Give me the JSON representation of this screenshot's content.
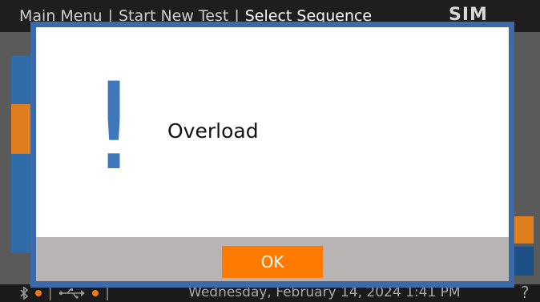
{
  "header": {
    "breadcrumb": [
      "Main Menu",
      "Start New Test",
      "Select Sequence"
    ],
    "separator": "|",
    "brand": "SIM"
  },
  "statusbar": {
    "separator": "|",
    "datetime": "Wednesday, February 14, 2024 1:41 PM",
    "icons": [
      "bluetooth-icon",
      "usb-icon",
      "help-icon"
    ],
    "indicator_color": "#f07a13"
  },
  "dialog": {
    "icon": "exclamation-icon",
    "icon_glyph": "!",
    "message": "Overload",
    "ok_label": "OK",
    "accent": "#3c69a8",
    "button_color": "#ff7a00"
  }
}
